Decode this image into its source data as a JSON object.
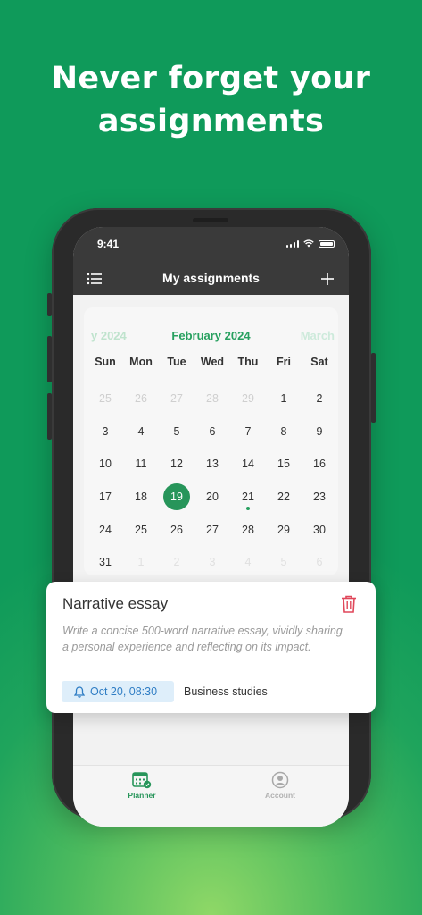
{
  "headline": {
    "line1": "Never forget your",
    "line2": "assignments"
  },
  "status": {
    "time": "9:41"
  },
  "appbar": {
    "title": "My assignments",
    "menu_icon": "list-icon",
    "add_icon": "plus-icon"
  },
  "calendar": {
    "prev_month": "y 2024",
    "current_month": "February 2024",
    "next_month": "March",
    "weekdays": [
      "Sun",
      "Mon",
      "Tue",
      "Wed",
      "Thu",
      "Fri",
      "Sat"
    ],
    "weeks": [
      [
        "25",
        "26",
        "27",
        "28",
        "29",
        "1",
        "2"
      ],
      [
        "3",
        "4",
        "5",
        "6",
        "7",
        "8",
        "9"
      ],
      [
        "10",
        "11",
        "12",
        "13",
        "14",
        "15",
        "16"
      ],
      [
        "17",
        "18",
        "19",
        "20",
        "21",
        "22",
        "23"
      ],
      [
        "24",
        "25",
        "26",
        "27",
        "28",
        "29",
        "30"
      ],
      [
        "31",
        "1",
        "2",
        "3",
        "4",
        "5",
        "6"
      ]
    ],
    "selected_day": "19",
    "event_dot_day": "21"
  },
  "card": {
    "title": "Narrative essay",
    "description": "Write a concise 500-word narrative essay, vividly sharing a personal experience and reflecting on its impact.",
    "due": "Oct 20, 08:30",
    "subject": "Business studies",
    "delete_icon": "trash-icon",
    "delete_color": "#e0475a"
  },
  "tabs": {
    "planner": "Planner",
    "account": "Account"
  },
  "colors": {
    "background": "#0f9a5a",
    "accent": "#27955a",
    "badge": "#deeefa"
  }
}
